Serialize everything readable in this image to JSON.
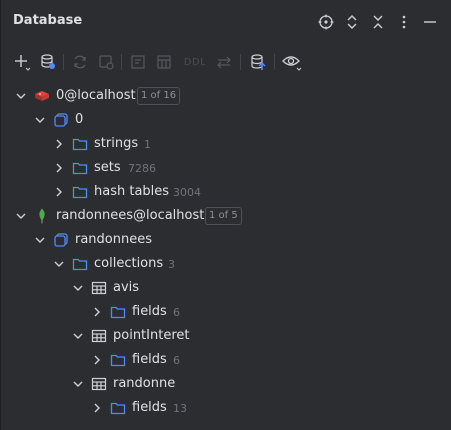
{
  "header": {
    "title": "Database",
    "icons": [
      "crosshair-icon",
      "expand-collapse-icon",
      "collapse-all-icon",
      "more-vertical-icon",
      "minimize-icon"
    ]
  },
  "toolbar": {
    "ddl_label": "DDL"
  },
  "tree": {
    "redis": {
      "label": "0@localhost",
      "badge": "1 of 16",
      "schema": {
        "label": "0",
        "children": [
          {
            "label": "strings",
            "count": "1"
          },
          {
            "label": "sets",
            "count": "7286"
          },
          {
            "label": "hash tables",
            "count": "3004"
          }
        ]
      }
    },
    "mongo": {
      "label": "randonnees@localhost",
      "badge": "1 of 5",
      "schema": {
        "label": "randonnees",
        "collections": {
          "label": "collections",
          "count": "3",
          "items": [
            {
              "label": "avis",
              "fields_label": "fields",
              "fields_count": "6"
            },
            {
              "label": "pointInteret",
              "fields_label": "fields",
              "fields_count": "6"
            },
            {
              "label": "randonne",
              "fields_label": "fields",
              "fields_count": "13"
            }
          ]
        }
      }
    }
  },
  "colors": {
    "background": "#2b2d30",
    "text": "#dfe1e5",
    "muted": "#6f737a",
    "folder": "#548af7",
    "redis": "#e0423c",
    "mongo": "#4fa94d"
  }
}
